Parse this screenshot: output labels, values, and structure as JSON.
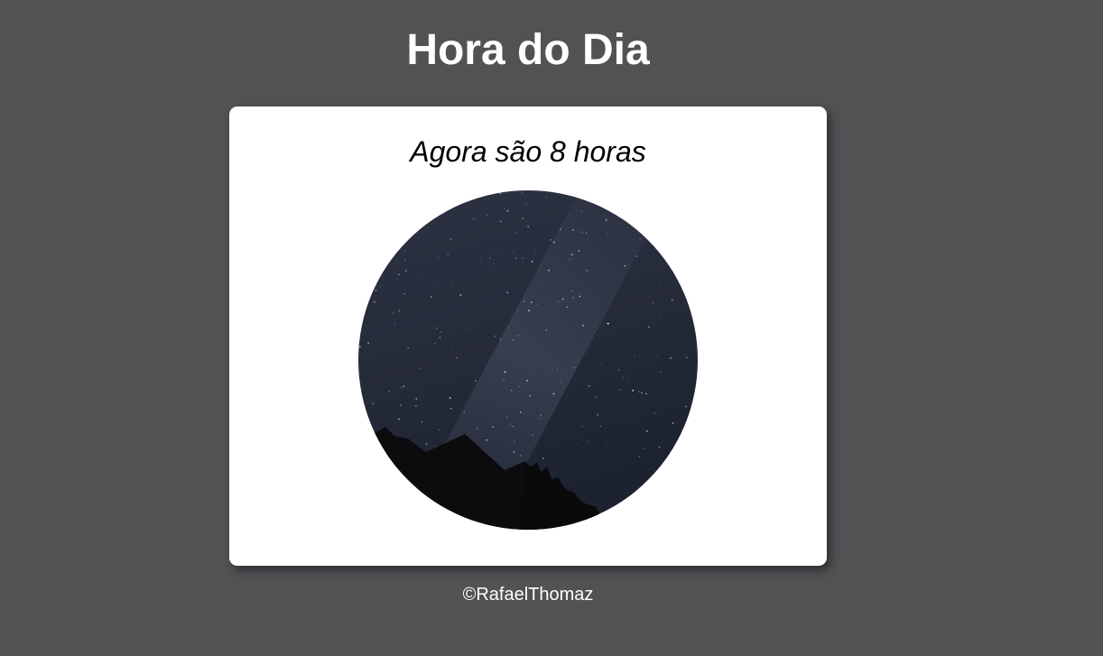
{
  "header": {
    "title": "Hora do Dia"
  },
  "card": {
    "message": "Agora são 8 horas",
    "image": {
      "icon": "night-sky-photo",
      "scene": "night"
    }
  },
  "footer": {
    "copyright": "©RafaelThomaz"
  },
  "colors": {
    "background": "#525255",
    "card": "#ffffff",
    "sky": "#262c3b",
    "silhouette": "#0c0c0e"
  }
}
